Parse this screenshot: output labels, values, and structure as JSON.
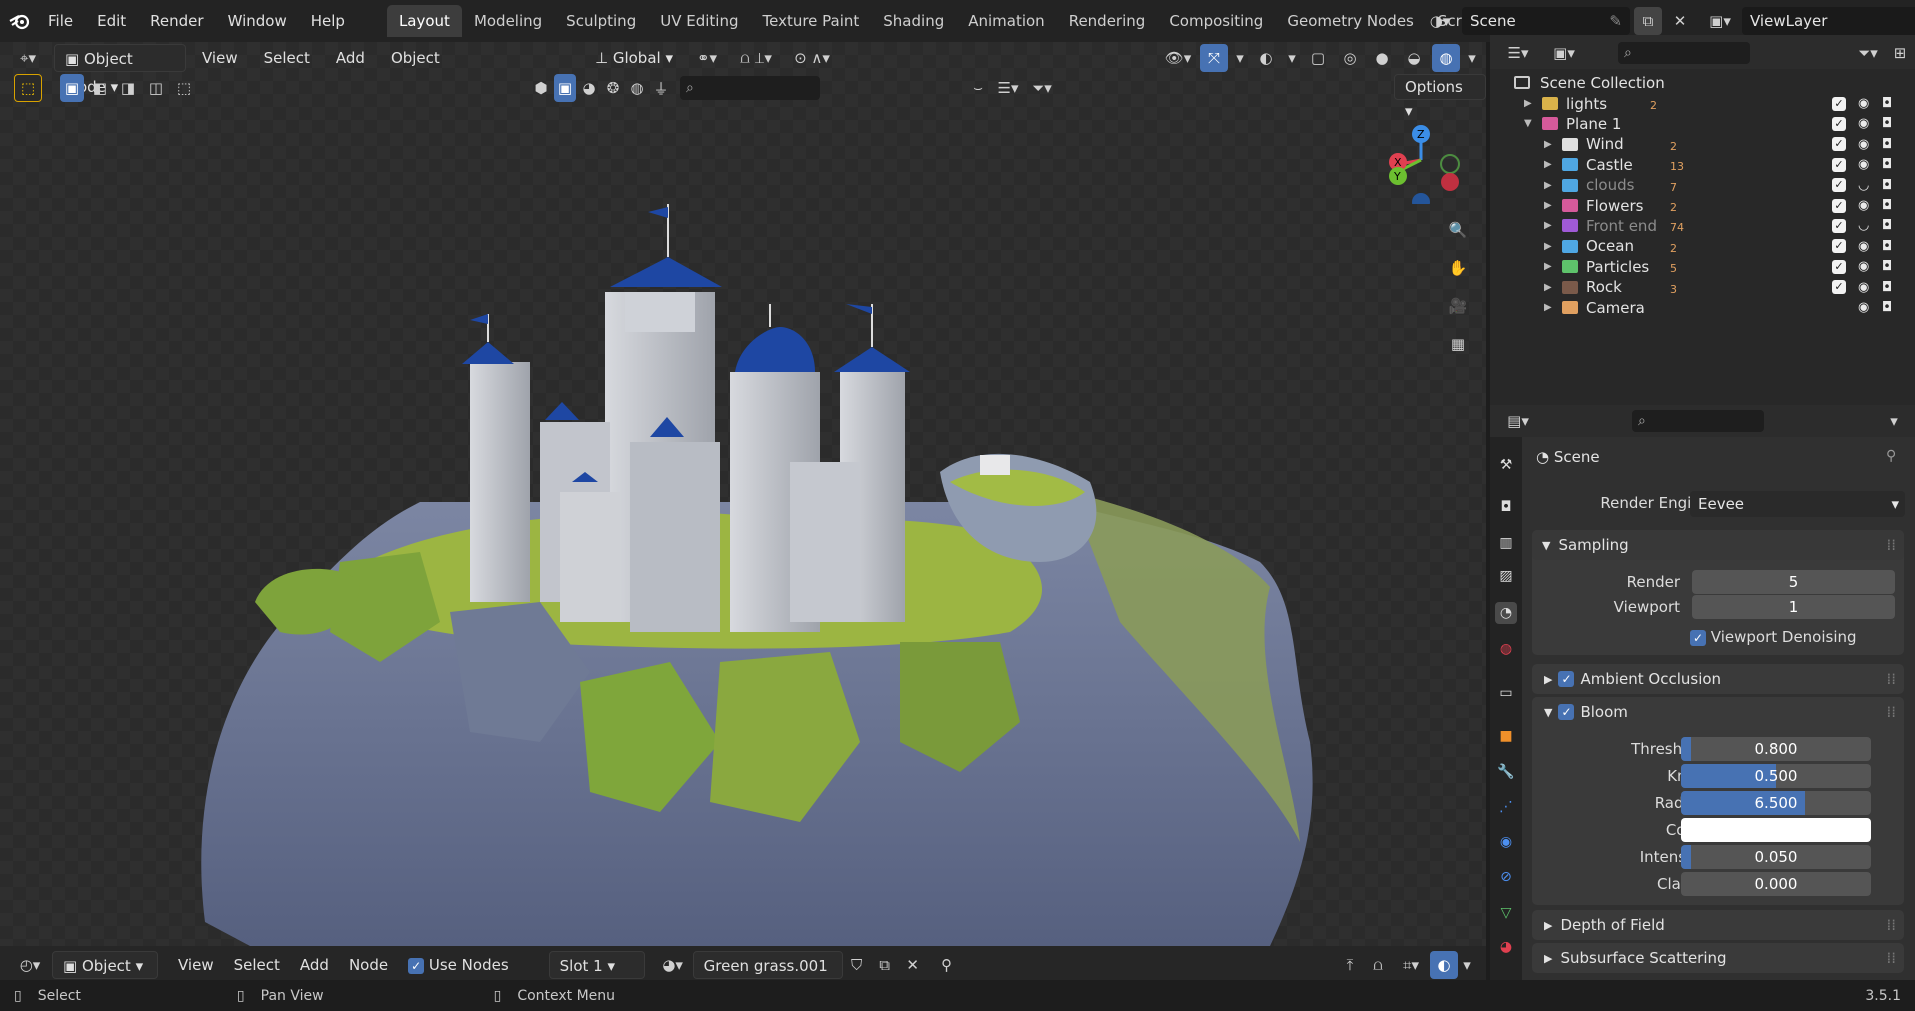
{
  "menu": [
    "File",
    "Edit",
    "Render",
    "Window",
    "Help"
  ],
  "workspaces": [
    "Layout",
    "Modeling",
    "Sculpting",
    "UV Editing",
    "Texture Paint",
    "Shading",
    "Animation",
    "Rendering",
    "Compositing",
    "Geometry Nodes",
    "Scripting"
  ],
  "active_workspace": "Layout",
  "scene_name": "Scene",
  "view_layer": "ViewLayer",
  "viewport_header": {
    "mode": "Object Mode",
    "menus": [
      "View",
      "Select",
      "Add",
      "Object"
    ],
    "orientation": "Global",
    "options_label": "Options"
  },
  "outliner": {
    "root": "Scene Collection",
    "items": [
      {
        "label": "lights",
        "color": "#d9b24a",
        "badge": "2",
        "dim": false
      },
      {
        "label": "Plane 1",
        "color": "#d65a9a",
        "badge": "",
        "dim": false
      },
      {
        "label": "Wind",
        "color": "#e0e0e0",
        "badge": "2",
        "dim": false
      },
      {
        "label": "Castle",
        "color": "#4fa7e3",
        "badge": "13",
        "dim": false
      },
      {
        "label": "clouds",
        "color": "#4fa7e3",
        "badge": "7",
        "dim": true
      },
      {
        "label": "Flowers",
        "color": "#d65a9a",
        "badge": "2",
        "dim": false
      },
      {
        "label": "Front end",
        "color": "#a05ad6",
        "badge": "74",
        "dim": true
      },
      {
        "label": "Ocean",
        "color": "#4fa7e3",
        "badge": "2",
        "dim": false
      },
      {
        "label": "Particles",
        "color": "#5ec36b",
        "badge": "5",
        "dim": false
      },
      {
        "label": "Rock",
        "color": "#7a5a4a",
        "badge": "3",
        "dim": false
      },
      {
        "label": "Camera",
        "color": "#e0a060",
        "badge": "",
        "dim": false
      }
    ]
  },
  "properties": {
    "context": "Scene",
    "render_engine_label": "Render Engine",
    "render_engine": "Eevee",
    "sampling": {
      "title": "Sampling",
      "render_label": "Render",
      "render": "5",
      "viewport_label": "Viewport",
      "viewport": "1",
      "denoise_label": "Viewport Denoising"
    },
    "ambient_occlusion": "Ambient Occlusion",
    "bloom": {
      "title": "Bloom",
      "threshold_label": "Threshold",
      "threshold": "0.800",
      "threshold_fill": 0.05,
      "knee_label": "Knee",
      "knee": "0.500",
      "knee_fill": 0.5,
      "radius_label": "Radius",
      "radius": "6.500",
      "radius_fill": 0.65,
      "color_label": "Color",
      "color": "#ffffff",
      "intensity_label": "Intensity",
      "intensity": "0.050",
      "intensity_fill": 0.05,
      "clamp_label": "Clamp",
      "clamp": "0.000",
      "clamp_fill": 0
    },
    "depth_of_field": "Depth of Field",
    "subsurface": "Subsurface Scattering"
  },
  "node_header": {
    "type": "Object",
    "menus": [
      "View",
      "Select",
      "Add",
      "Node"
    ],
    "use_nodes": "Use Nodes",
    "slot": "Slot 1",
    "material": "Green grass.001"
  },
  "status": {
    "select": "Select",
    "pan": "Pan View",
    "context": "Context Menu",
    "version": "3.5.1"
  }
}
